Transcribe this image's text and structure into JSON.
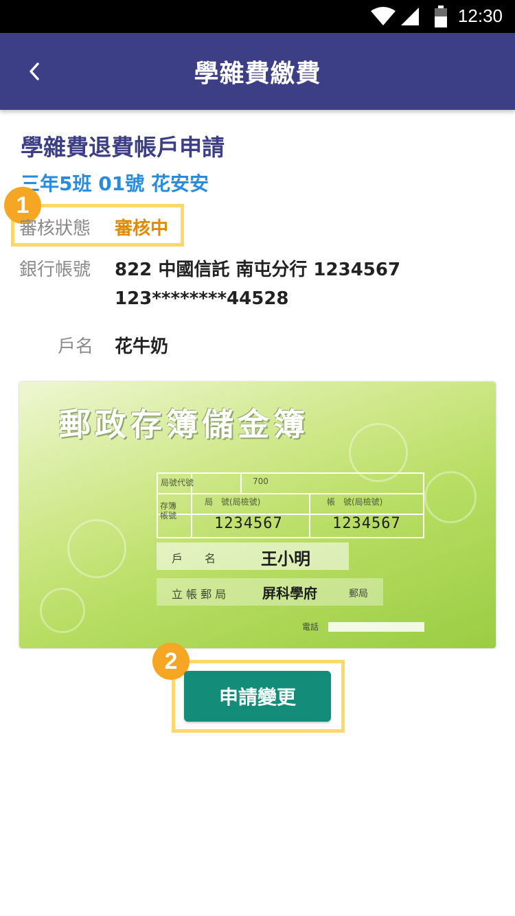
{
  "status_bar": {
    "time": "12:30"
  },
  "app_bar": {
    "title": "學雜費繳費"
  },
  "page": {
    "section_title": "學雜費退費帳戶申請",
    "student_info": "三年5班 01號 花安安"
  },
  "review": {
    "label": "審核狀態",
    "value": "審核中",
    "value_color": "#e08a00",
    "badge": "1"
  },
  "bank": {
    "label": "銀行帳號",
    "line1": "822 中國信託 南屯分行 1234567",
    "line2": "123********44528"
  },
  "holder": {
    "label": "戶名",
    "value": "花牛奶"
  },
  "passbook_image": {
    "title": "郵政存簿儲金簿",
    "bureau_code_label": "局號代號",
    "bureau_code": "700",
    "account_label_vertical": "存簿帳號",
    "col1_header": "局　號(局檢號)",
    "col2_header": "帳　號(局檢號)",
    "office_number": "1234567",
    "account_number": "1234567",
    "name_label": "戶　　名",
    "name_value": "王小明",
    "office_label": "立 帳 郵 局",
    "office_value": "屏科學府",
    "office_suffix": "郵局",
    "phone_label": "電話"
  },
  "action": {
    "button_label": "申請變更",
    "badge": "2"
  },
  "colors": {
    "app_bar": "#3c3f86",
    "accent_blue": "#2a8bdc",
    "button": "#138c7a",
    "highlight": "#ffd76a",
    "badge": "#f5a623"
  }
}
